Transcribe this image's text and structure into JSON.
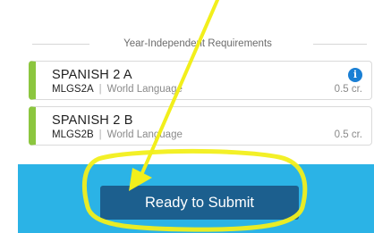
{
  "section": {
    "title": "Year-Independent Requirements"
  },
  "courses": [
    {
      "title": "SPANISH 2 A",
      "code": "MLGS2A",
      "separator": "|",
      "category": "World Language",
      "credits": "0.5 cr.",
      "accent_color": "#8cc63f",
      "has_info_icon": true,
      "info_icon": "info-icon"
    },
    {
      "title": "SPANISH 2 B",
      "code": "MLGS2B",
      "separator": "|",
      "category": "World Language",
      "credits": "0.5 cr.",
      "accent_color": "#8cc63f",
      "has_info_icon": false
    }
  ],
  "footer": {
    "submit_label": "Ready to Submit",
    "bar_color": "#2bb3e6",
    "button_color": "#1c5f8e"
  },
  "annotation": {
    "arrow_color": "#f2ef1b",
    "highlight_color": "#f2ef1b"
  }
}
